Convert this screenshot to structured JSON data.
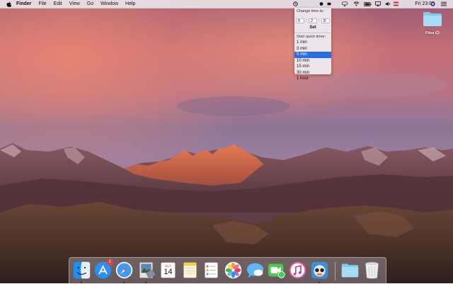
{
  "menubar": {
    "apple_icon": "apple-logo",
    "app_name": "Finder",
    "items": [
      "File",
      "Edit",
      "View",
      "Go",
      "Window",
      "Help"
    ],
    "status_icons": [
      "timer-icon",
      "timer-icon",
      "timer-icon",
      "timer-icon",
      "airplay-icon",
      "wifi-icon",
      "battery-icon",
      "display-icon",
      "volume-icon",
      "flag-icon"
    ],
    "clock": "Fri 23:09",
    "search_icon": "search-icon",
    "user_icon": "siri-icon",
    "list_icon": "notification-center-icon"
  },
  "timer_popup": {
    "change_time_label": "Change time to:",
    "hours": "0",
    "minutes": "2",
    "seconds": "8",
    "set_label": "Set",
    "quick_timer_label": "Start quick timer:",
    "quick_timers": [
      {
        "label": "1 min",
        "selected": false
      },
      {
        "label": "3 min",
        "selected": false
      },
      {
        "label": "5 min",
        "selected": true
      },
      {
        "label": "10 min",
        "selected": false
      },
      {
        "label": "15 min",
        "selected": false
      },
      {
        "label": "30 min",
        "selected": false
      },
      {
        "label": "1 hour",
        "selected": false
      }
    ],
    "selected_color": "#2a6ee6"
  },
  "desktop": {
    "icon_label": "Files",
    "icon_badge": "cloud-icon"
  },
  "dock": {
    "apps": [
      {
        "name": "Finder",
        "icon": "finder-icon",
        "running": true
      },
      {
        "name": "App Store",
        "icon": "app-store-icon",
        "badge": "1",
        "running": false
      },
      {
        "name": "Safari",
        "icon": "safari-icon",
        "running": true
      },
      {
        "name": "Preview",
        "icon": "preview-icon",
        "running": true
      },
      {
        "name": "Calendar",
        "icon": "calendar-icon",
        "month": "OCT",
        "day": "14",
        "running": false
      },
      {
        "name": "Notes",
        "icon": "notes-icon",
        "running": false
      },
      {
        "name": "Reminders",
        "icon": "reminders-icon",
        "running": false
      },
      {
        "name": "Photos",
        "icon": "photos-icon",
        "running": false
      },
      {
        "name": "Messages",
        "icon": "messages-icon",
        "running": false
      },
      {
        "name": "FaceTime",
        "icon": "facetime-icon",
        "running": false
      },
      {
        "name": "iTunes",
        "icon": "itunes-icon",
        "running": false
      },
      {
        "name": "Tweetbot",
        "icon": "tweetbot-icon",
        "running": true
      },
      {
        "name": "Downloads",
        "icon": "folder-icon",
        "running": false
      },
      {
        "name": "Trash",
        "icon": "trash-icon",
        "running": false
      }
    ]
  }
}
